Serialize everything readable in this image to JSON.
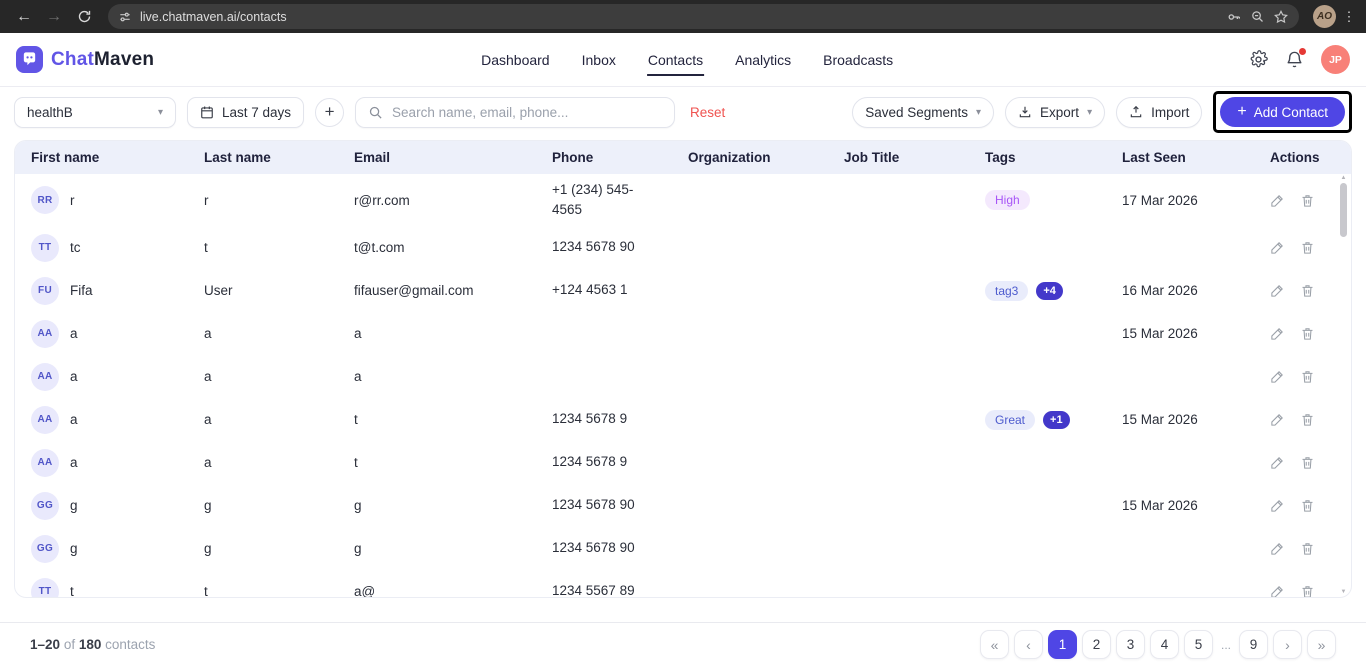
{
  "colors": {
    "accent": "#4f46e5",
    "logo": "#6155e6",
    "reset": "#ef5350",
    "thead_bg": "#edf0fa",
    "avatar_bg": "#e9e9fc",
    "avatar_ink": "#5156c8",
    "tag_purple_bg": "#f4e9fd",
    "tag_purple_ink": "#a855f7",
    "tag_indigo_bg": "#e9ecfb",
    "tag_indigo_ink": "#4d5bce",
    "count_bg": "#4338ca",
    "dot": "#e53935",
    "jp": "#f88078"
  },
  "browser": {
    "url": "live.chatmaven.ai/contacts",
    "profile_initials": "AO"
  },
  "header": {
    "brand_first": "Chat",
    "brand_second": "Maven",
    "nav": [
      {
        "label": "Dashboard",
        "active": false
      },
      {
        "label": "Inbox",
        "active": false
      },
      {
        "label": "Contacts",
        "active": true
      },
      {
        "label": "Analytics",
        "active": false
      },
      {
        "label": "Broadcasts",
        "active": false
      }
    ],
    "user_initials": "JP"
  },
  "toolbar": {
    "segment_value": "healthB",
    "date_filter": "Last 7 days",
    "search_placeholder": "Search name, email, phone...",
    "reset_label": "Reset",
    "saved_segments_label": "Saved Segments",
    "export_label": "Export",
    "import_label": "Import",
    "add_contact_label": "Add Contact"
  },
  "table": {
    "columns": [
      "First name",
      "Last name",
      "Email",
      "Phone",
      "Organization",
      "Job Title",
      "Tags",
      "Last Seen",
      "Actions"
    ],
    "rows": [
      {
        "initials": "RR",
        "first": "r",
        "last": "r",
        "email": "r@rr.com",
        "phone": "+1 (234) 545-4565",
        "org": "",
        "job": "",
        "tags": [
          {
            "label": "High",
            "variant": "purple"
          }
        ],
        "last_seen": "17 Mar 2026"
      },
      {
        "initials": "TT",
        "first": "tc",
        "last": "t",
        "email": "t@t.com",
        "phone": "1234 5678 90",
        "org": "",
        "job": "",
        "tags": [],
        "last_seen": ""
      },
      {
        "initials": "FU",
        "first": "Fifa",
        "last": "User",
        "email": "fifauser@gmail.com",
        "phone": "+124 4563 1",
        "org": "",
        "job": "",
        "tags": [
          {
            "label": "tag3",
            "variant": "indigo"
          },
          {
            "label": "+4",
            "variant": "count"
          }
        ],
        "last_seen": "16 Mar 2026"
      },
      {
        "initials": "AA",
        "first": "a",
        "last": "a",
        "email": "a",
        "phone": "",
        "org": "",
        "job": "",
        "tags": [],
        "last_seen": "15 Mar 2026"
      },
      {
        "initials": "AA",
        "first": "a",
        "last": "a",
        "email": "a",
        "phone": "",
        "org": "",
        "job": "",
        "tags": [],
        "last_seen": ""
      },
      {
        "initials": "AA",
        "first": "a",
        "last": "a",
        "email": "t",
        "phone": "1234 5678 9",
        "org": "",
        "job": "",
        "tags": [
          {
            "label": "Great",
            "variant": "indigo"
          },
          {
            "label": "+1",
            "variant": "count"
          }
        ],
        "last_seen": "15 Mar 2026"
      },
      {
        "initials": "AA",
        "first": "a",
        "last": "a",
        "email": "t",
        "phone": "1234 5678 9",
        "org": "",
        "job": "",
        "tags": [],
        "last_seen": ""
      },
      {
        "initials": "GG",
        "first": "g",
        "last": "g",
        "email": "g",
        "phone": "1234 5678 90",
        "org": "",
        "job": "",
        "tags": [],
        "last_seen": "15 Mar 2026"
      },
      {
        "initials": "GG",
        "first": "g",
        "last": "g",
        "email": "g",
        "phone": "1234 5678 90",
        "org": "",
        "job": "",
        "tags": [],
        "last_seen": ""
      },
      {
        "initials": "TT",
        "first": "t",
        "last": "t",
        "email": "a@",
        "phone": "1234 5567 89",
        "org": "",
        "job": "",
        "tags": [],
        "last_seen": ""
      }
    ]
  },
  "footer": {
    "range": "1–20",
    "of_word": "of",
    "total": "180",
    "noun": "contacts",
    "pagination": {
      "first": "«",
      "prev": "‹",
      "pages": [
        "1",
        "2",
        "3",
        "4",
        "5"
      ],
      "ellipsis": "...",
      "last_page": "9",
      "next": "›",
      "last": "»",
      "active": "1"
    }
  }
}
